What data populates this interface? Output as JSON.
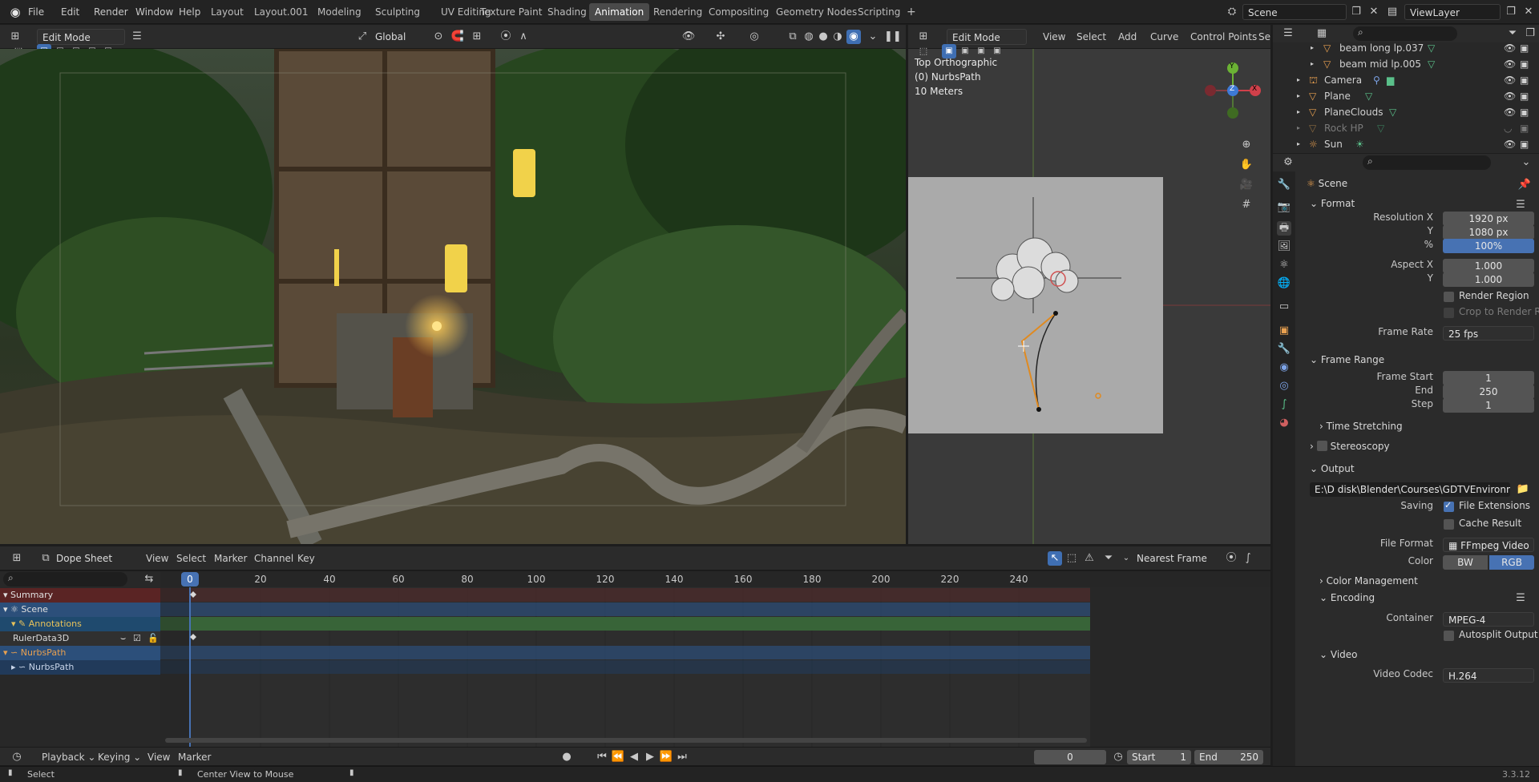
{
  "app": {
    "menu": [
      "File",
      "Edit",
      "Render",
      "Window",
      "Help"
    ],
    "workspaces": [
      "Layout",
      "Layout.001",
      "Modeling",
      "Sculpting",
      "UV Editing",
      "Texture Paint",
      "Shading",
      "Animation",
      "Rendering",
      "Compositing",
      "Geometry Nodes",
      "Scripting"
    ],
    "active_workspace": "Animation",
    "add_tab": "+",
    "scene_name": "Scene",
    "view_layer": "ViewLayer",
    "version": "3.3.12"
  },
  "viewport3d": {
    "mode": "Edit Mode",
    "transform_orientation": "Global"
  },
  "viewport2": {
    "mode": "Edit Mode",
    "menus": [
      "View",
      "Select",
      "Add",
      "Curve",
      "Control Points",
      "Segments"
    ],
    "overlay_lines": [
      "Top Orthographic",
      "(0) NurbsPath",
      "10 Meters"
    ],
    "gizmo": {
      "y": "Y",
      "z": "Z",
      "x": "X"
    }
  },
  "outliner": {
    "items": [
      {
        "name": "beam long lp.037",
        "dim": false
      },
      {
        "name": "beam mid lp.005",
        "dim": false
      },
      {
        "name": "Camera",
        "dim": false
      },
      {
        "name": "Plane",
        "dim": false
      },
      {
        "name": "PlaneClouds",
        "dim": false
      },
      {
        "name": "Rock HP",
        "dim": true
      },
      {
        "name": "Sun",
        "dim": false
      }
    ]
  },
  "properties": {
    "context": "Scene",
    "format_title": "Format",
    "resolution_x_label": "Resolution X",
    "resolution_x": "1920 px",
    "resolution_y_label": "Y",
    "resolution_y": "1080 px",
    "percent_label": "%",
    "percent": "100%",
    "aspect_x_label": "Aspect X",
    "aspect_x": "1.000",
    "aspect_y_label": "Y",
    "aspect_y": "1.000",
    "render_region": "Render Region",
    "crop_region": "Crop to Render Region",
    "frame_rate_label": "Frame Rate",
    "frame_rate": "25 fps",
    "frame_range_title": "Frame Range",
    "frame_start_label": "Frame Start",
    "frame_start": "1",
    "end_label": "End",
    "end": "250",
    "step_label": "Step",
    "step": "1",
    "time_stretching": "Time Stretching",
    "stereoscopy": "Stereoscopy",
    "output_title": "Output",
    "output_path": "E:\\D disk\\Blender\\Courses\\GDTVEnvironment\\",
    "saving_label": "Saving",
    "file_extensions": "File Extensions",
    "cache_result": "Cache Result",
    "file_format_label": "File Format",
    "file_format": "FFmpeg Video",
    "color_label": "Color",
    "color_bw": "BW",
    "color_rgb": "RGB",
    "color_management": "Color Management",
    "encoding_title": "Encoding",
    "container_label": "Container",
    "container": "MPEG-4",
    "autosplit": "Autosplit Output",
    "video_title": "Video",
    "video_codec_label": "Video Codec",
    "video_codec": "H.264"
  },
  "dopesheet": {
    "mode": "Dope Sheet",
    "menus": [
      "View",
      "Select",
      "Marker",
      "Channel",
      "Key"
    ],
    "snap": "Nearest Frame",
    "current_frame": "0",
    "ticks": [
      "20",
      "40",
      "60",
      "80",
      "100",
      "120",
      "140",
      "160",
      "180",
      "200",
      "220",
      "240"
    ],
    "channels": [
      "Summary",
      "Scene",
      "Annotations",
      "RulerData3D",
      "NurbsPath",
      "NurbsPath"
    ]
  },
  "timeline": {
    "menus": [
      "Playback",
      "Keying",
      "View",
      "Marker"
    ],
    "frame": "0",
    "start_label": "Start",
    "start": "1",
    "end_label": "End",
    "end": "250"
  },
  "statusbar": {
    "select": "Select",
    "center_view": "Center View to Mouse"
  }
}
